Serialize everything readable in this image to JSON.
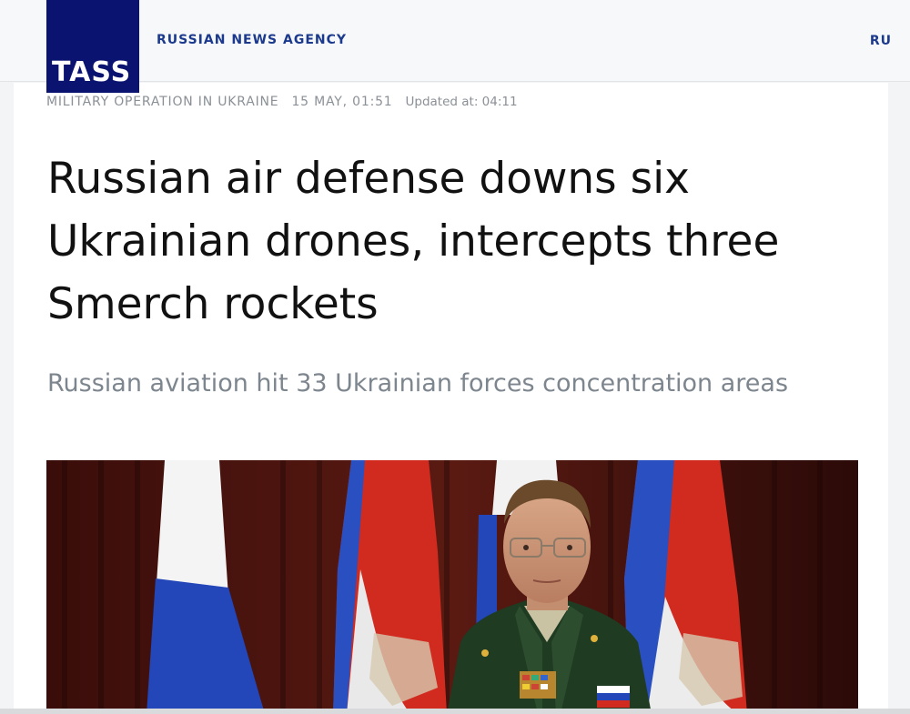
{
  "header": {
    "logo_text": "TASS",
    "agency_name": "RUSSIAN NEWS AGENCY",
    "language": "RU"
  },
  "article": {
    "category": "MILITARY OPERATION IN UKRAINE",
    "date": "15 MAY, 01:51",
    "updated": "Updated at: 04:11",
    "title": "Russian air defense downs six Ukrainian drones, intercepts three Smerch rockets",
    "subtitle": "Russian aviation hit 33 Ukrainian forces concentration areas"
  },
  "colors": {
    "brand_navy": "#0a1470",
    "link_blue": "#1b3a8e",
    "meta_gray": "#8a9096",
    "subtitle_gray": "#7d868e"
  }
}
